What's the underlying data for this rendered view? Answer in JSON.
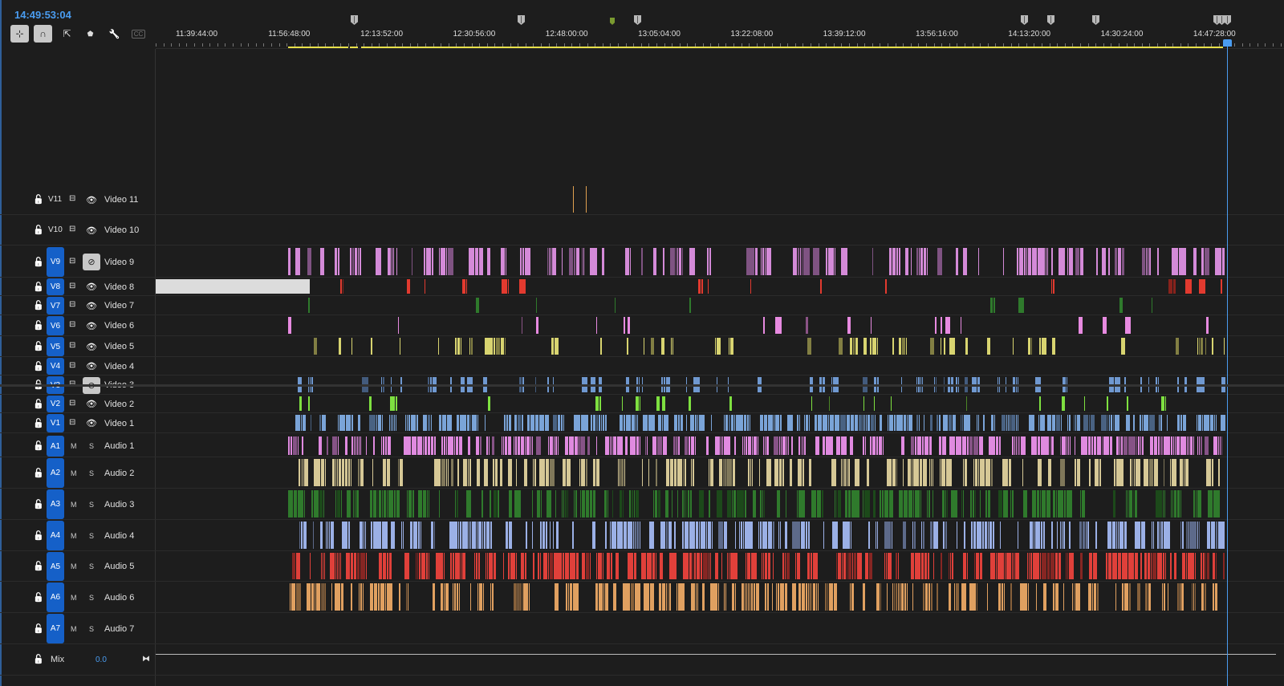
{
  "timecode": "14:49:53:04",
  "toolbar": {
    "insert_icon": "⊹",
    "snap_icon": "∩",
    "linked_icon": "⇱",
    "marker_icon": "⬟",
    "wrench_icon": "🔧",
    "cc_label": "CC"
  },
  "ruler": {
    "labels": [
      "11:39:44:00",
      "11:56:48:00",
      "12:13:52:00",
      "12:30:56:00",
      "12:48:00:00",
      "13:05:04:00",
      "13:22:08:00",
      "13:39:12:00",
      "13:56:16:00",
      "14:13:20:00",
      "14:30:24:00",
      "14:47:28:00"
    ]
  },
  "video_tracks": [
    {
      "id": "V11",
      "name": "Video 11",
      "targeted": false,
      "visible": true,
      "color": "#e0a050",
      "density": 0
    },
    {
      "id": "V10",
      "name": "Video 10",
      "targeted": false,
      "visible": true,
      "color": "#888888",
      "density": 0
    },
    {
      "id": "V9",
      "name": "Video 9",
      "targeted": true,
      "visible": false,
      "color": "#d48ad8",
      "density": 0.55
    },
    {
      "id": "V8",
      "name": "Video 8",
      "targeted": true,
      "visible": true,
      "color": "#e23a2f",
      "density": 0.05
    },
    {
      "id": "V7",
      "name": "Video 7",
      "targeted": true,
      "visible": true,
      "color": "#2f7a2c",
      "density": 0.05
    },
    {
      "id": "V6",
      "name": "Video 6",
      "targeted": true,
      "visible": true,
      "color": "#e78ae0",
      "density": 0.06
    },
    {
      "id": "V5",
      "name": "Video 5",
      "targeted": true,
      "visible": true,
      "color": "#d8d470",
      "density": 0.25
    },
    {
      "id": "V4",
      "name": "Video 4",
      "targeted": true,
      "visible": true,
      "color": "#e78ae0",
      "density": 0.005
    },
    {
      "id": "V3",
      "name": "Video 3",
      "targeted": true,
      "visible": false,
      "color": "#6f98d0",
      "density": 0.3
    },
    {
      "id": "V2",
      "name": "Video 2",
      "targeted": true,
      "visible": true,
      "color": "#7ee040",
      "density": 0.12
    },
    {
      "id": "V1",
      "name": "Video 1",
      "targeted": true,
      "visible": true,
      "color": "#7aa4d8",
      "density": 0.7
    }
  ],
  "audio_tracks": [
    {
      "id": "A1",
      "name": "Audio 1",
      "color": "#e08ae0",
      "density": 0.7
    },
    {
      "id": "A2",
      "name": "Audio 2",
      "color": "#d6c896",
      "density": 0.55
    },
    {
      "id": "A3",
      "name": "Audio 3",
      "color": "#2f7a2c",
      "density": 0.55
    },
    {
      "id": "A4",
      "name": "Audio 4",
      "color": "#9bb0e6",
      "density": 0.6
    },
    {
      "id": "A5",
      "name": "Audio 5",
      "color": "#e0403a",
      "density": 0.65
    },
    {
      "id": "A6",
      "name": "Audio 6",
      "color": "#e0a060",
      "density": 0.55
    },
    {
      "id": "A7",
      "name": "Audio 7",
      "color": "#888888",
      "density": 0
    }
  ],
  "audio_labels": {
    "mute": "M",
    "solo": "S"
  },
  "mix": {
    "label": "Mix",
    "value": "0.0"
  },
  "icons": {
    "lock": "🔓",
    "sync": "⊟",
    "eye": "👁",
    "eye_off": "⊘"
  }
}
